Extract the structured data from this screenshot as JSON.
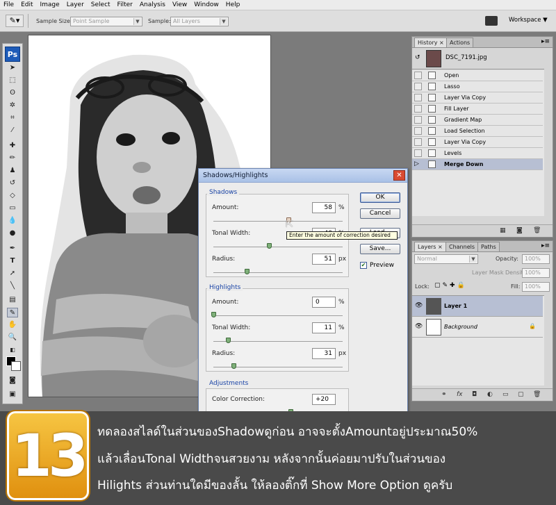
{
  "menu": [
    "File",
    "Edit",
    "Image",
    "Layer",
    "Select",
    "Filter",
    "Analysis",
    "View",
    "Window",
    "Help"
  ],
  "options_bar": {
    "sample_size_label": "Sample Size:",
    "sample_size_value": "Point Sample",
    "sample_label": "Sample:",
    "sample_value": "All Layers",
    "workspace_label": "Workspace ▼"
  },
  "toolbox": {
    "logo": "Ps"
  },
  "history_panel": {
    "tabs": [
      "History ×",
      "Actions"
    ],
    "snapshot": "DSC_7191.jpg",
    "items": [
      "Open",
      "Lasso",
      "Layer Via Copy",
      "Fill Layer",
      "Gradient Map",
      "Load Selection",
      "Layer Via Copy",
      "Levels",
      "Merge Down"
    ]
  },
  "layers_panel": {
    "tabs": [
      "Layers ×",
      "Channels",
      "Paths"
    ],
    "blend_mode": "Normal",
    "opacity_label": "Opacity:",
    "opacity_value": "100%",
    "layer_mask_density_label": "Layer Mask Density:",
    "layer_mask_density_value": "100%",
    "lock_label": "Lock:",
    "fill_label": "Fill:",
    "fill_value": "100%",
    "layers": [
      {
        "name": "Layer 1",
        "selected": true
      },
      {
        "name": "Background",
        "italic": true,
        "locked": true
      }
    ]
  },
  "dialog": {
    "title": "Shadows/Highlights",
    "shadows": {
      "title": "Shadows",
      "amount_label": "Amount:",
      "amount_value": "58",
      "amount_unit": "%",
      "tonal_label": "Tonal Width:",
      "tonal_value": "40",
      "tonal_unit": "%",
      "radius_label": "Radius:",
      "radius_value": "51",
      "radius_unit": "px"
    },
    "highlights": {
      "title": "Highlights",
      "amount_label": "Amount:",
      "amount_value": "0",
      "amount_unit": "%",
      "tonal_label": "Tonal Width:",
      "tonal_value": "11",
      "tonal_unit": "%",
      "radius_label": "Radius:",
      "radius_value": "31",
      "radius_unit": "px"
    },
    "adjustments": {
      "title": "Adjustments",
      "color_correction_label": "Color Correction:",
      "color_correction_value": "+20"
    },
    "buttons": {
      "ok": "OK",
      "cancel": "Cancel",
      "load": "Load...",
      "save": "Save..."
    },
    "preview_label": "Preview",
    "tooltip": "Enter the amount of correction desired"
  },
  "banner": {
    "step_number": "13",
    "lines": [
      "ทดลองสไลด์ในส่วนของShadowดูก่อน อาจจะตั้งAmountอยู่ประมาณ50%",
      "แล้วเลื่อนTonal Widthจนสวยงาม หลังจากนั้นค่อยมาปรับในส่วนของ",
      "Hilights  ส่วนท่านใดมีของลั้น ให้ลองติ๊กที่ Show More Option ดูครับ"
    ]
  }
}
